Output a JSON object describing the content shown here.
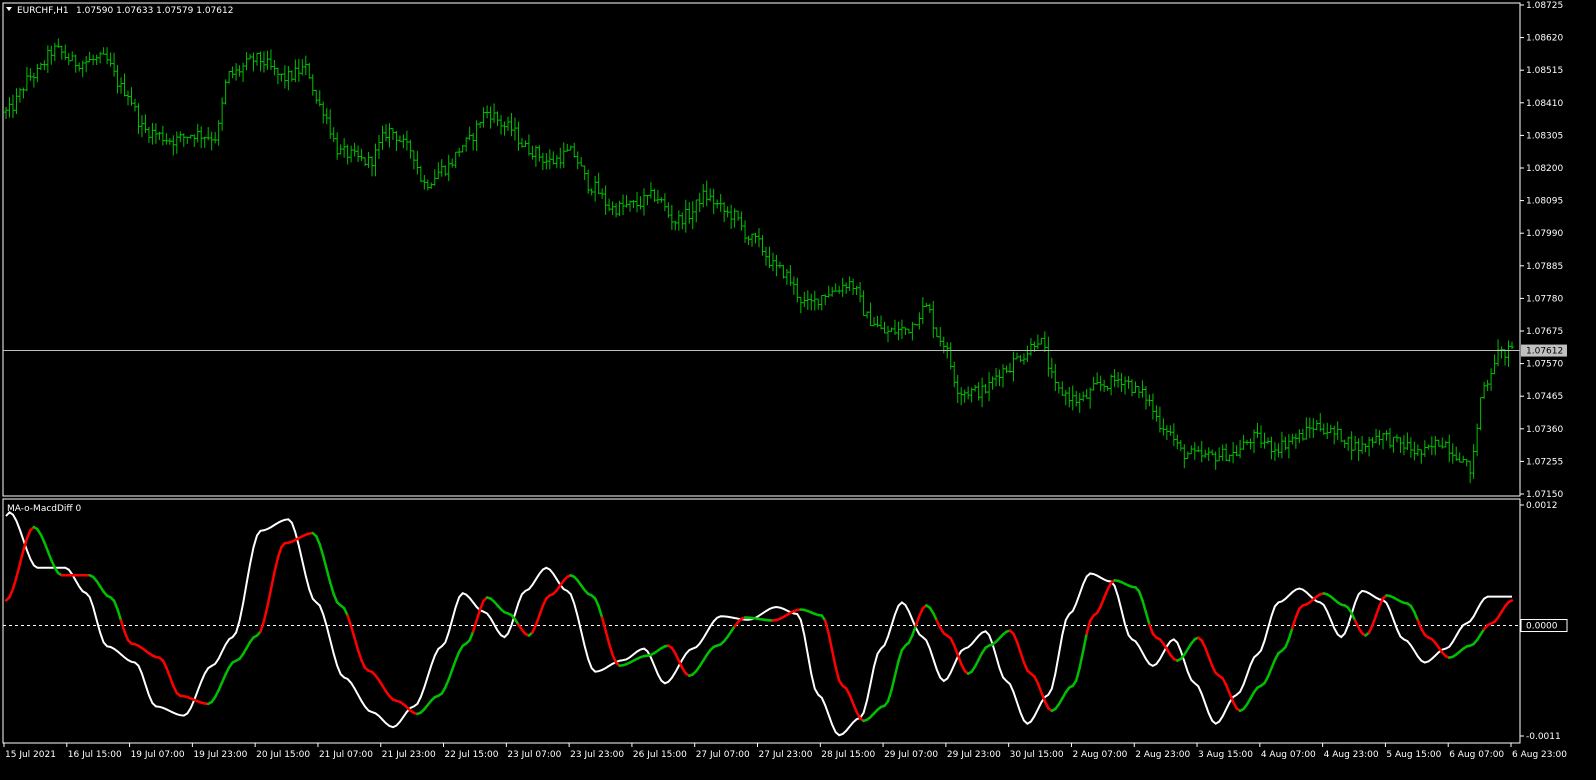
{
  "header": {
    "symbol_text": "EURCHF,H1",
    "ohlc_text": "1.07590 1.07633 1.07579 1.07612"
  },
  "indicator": {
    "name_text": "MA-o-MacdDiff 0",
    "zero_label": "0.0000"
  },
  "colors": {
    "background": "#000000",
    "frame": "#ffffff",
    "bars": "#00c000",
    "bid_line": "#c0c0c0",
    "signal_line": "#ffffff",
    "osc_up": "#00c000",
    "osc_down": "#ff0000",
    "zero_line": "#ffffff"
  },
  "chart_data": [
    {
      "type": "bar",
      "symbol": "EURCHF",
      "timeframe": "H1",
      "ylim": [
        1.0715,
        1.08725
      ],
      "yticks": [
        "1.08725",
        "1.08620",
        "1.08515",
        "1.08410",
        "1.08305",
        "1.08200",
        "1.08095",
        "1.07990",
        "1.07885",
        "1.07780",
        "1.07675",
        "1.07570",
        "1.07465",
        "1.07360",
        "1.07255",
        "1.07150"
      ],
      "current_price_label": "1.07612",
      "current_price": 1.07612,
      "xticks": [
        "15 Jul 2021",
        "16 Jul 15:00",
        "19 Jul 07:00",
        "19 Jul 23:00",
        "20 Jul 15:00",
        "21 Jul 07:00",
        "21 Jul 23:00",
        "22 Jul 15:00",
        "23 Jul 07:00",
        "23 Jul 23:00",
        "26 Jul 15:00",
        "27 Jul 07:00",
        "27 Jul 23:00",
        "28 Jul 15:00",
        "29 Jul 07:00",
        "29 Jul 23:00",
        "30 Jul 15:00",
        "2 Aug 07:00",
        "2 Aug 23:00",
        "3 Aug 15:00",
        "4 Aug 07:00",
        "4 Aug 23:00",
        "5 Aug 15:00",
        "6 Aug 07:00",
        "6 Aug 23:00"
      ],
      "close_anchors": [
        [
          0,
          1.0838
        ],
        [
          8,
          1.085
        ],
        [
          14,
          1.0858
        ],
        [
          20,
          1.0854
        ],
        [
          28,
          1.0855
        ],
        [
          34,
          1.0845
        ],
        [
          40,
          1.0832
        ],
        [
          48,
          1.0829
        ],
        [
          54,
          1.0831
        ],
        [
          60,
          1.083
        ],
        [
          64,
          1.085
        ],
        [
          72,
          1.0855
        ],
        [
          80,
          1.0849
        ],
        [
          86,
          1.0852
        ],
        [
          90,
          1.084
        ],
        [
          96,
          1.0825
        ],
        [
          104,
          1.0822
        ],
        [
          110,
          1.0832
        ],
        [
          116,
          1.0826
        ],
        [
          120,
          1.0815
        ],
        [
          126,
          1.082
        ],
        [
          132,
          1.0828
        ],
        [
          138,
          1.0838
        ],
        [
          144,
          1.0833
        ],
        [
          150,
          1.0826
        ],
        [
          156,
          1.0822
        ],
        [
          162,
          1.0825
        ],
        [
          168,
          1.0814
        ],
        [
          174,
          1.0807
        ],
        [
          180,
          1.0808
        ],
        [
          186,
          1.0811
        ],
        [
          192,
          1.0803
        ],
        [
          196,
          1.0805
        ],
        [
          200,
          1.0811
        ],
        [
          208,
          1.0805
        ],
        [
          214,
          1.0797
        ],
        [
          222,
          1.0787
        ],
        [
          230,
          1.0776
        ],
        [
          236,
          1.078
        ],
        [
          242,
          1.0783
        ],
        [
          248,
          1.0771
        ],
        [
          252,
          1.0767
        ],
        [
          258,
          1.0768
        ],
        [
          264,
          1.0775
        ],
        [
          268,
          1.0765
        ],
        [
          274,
          1.0748
        ],
        [
          280,
          1.0748
        ],
        [
          286,
          1.0755
        ],
        [
          292,
          1.076
        ],
        [
          296,
          1.0765
        ],
        [
          302,
          1.0748
        ],
        [
          308,
          1.0745
        ],
        [
          314,
          1.075
        ],
        [
          320,
          1.0752
        ],
        [
          326,
          1.0747
        ],
        [
          332,
          1.0737
        ],
        [
          338,
          1.0728
        ],
        [
          344,
          1.0727
        ],
        [
          352,
          1.0728
        ],
        [
          358,
          1.0733
        ],
        [
          364,
          1.073
        ],
        [
          370,
          1.0733
        ],
        [
          376,
          1.0737
        ],
        [
          382,
          1.0734
        ],
        [
          388,
          1.073
        ],
        [
          394,
          1.0734
        ],
        [
          400,
          1.0731
        ],
        [
          406,
          1.0728
        ],
        [
          412,
          1.0732
        ],
        [
          416,
          1.0728
        ],
        [
          420,
          1.0723
        ],
        [
          424,
          1.075
        ],
        [
          428,
          1.076
        ],
        [
          432,
          1.0761
        ]
      ],
      "osc_ylim": [
        -0.0011,
        0.0012
      ],
      "osc_yticks": [
        "0.0012",
        "0.0000",
        "-0.0011"
      ],
      "osc_anchors": [
        [
          0,
          0.00025
        ],
        [
          8,
          0.00098
        ],
        [
          16,
          0.0005
        ],
        [
          24,
          0.0005
        ],
        [
          30,
          0.00028
        ],
        [
          36,
          -0.00018
        ],
        [
          44,
          -0.00032
        ],
        [
          50,
          -0.0007
        ],
        [
          58,
          -0.00078
        ],
        [
          66,
          -0.00035
        ],
        [
          72,
          -0.0001
        ],
        [
          80,
          0.00082
        ],
        [
          88,
          0.00092
        ],
        [
          96,
          0.0002
        ],
        [
          104,
          -0.00045
        ],
        [
          112,
          -0.00075
        ],
        [
          118,
          -0.00088
        ],
        [
          124,
          -0.0007
        ],
        [
          132,
          -0.00018
        ],
        [
          138,
          0.00028
        ],
        [
          144,
          0.00012
        ],
        [
          150,
          -0.0001
        ],
        [
          156,
          0.0003
        ],
        [
          162,
          0.0005
        ],
        [
          168,
          0.0003
        ],
        [
          176,
          -0.0004
        ],
        [
          184,
          -0.0003
        ],
        [
          190,
          -0.0002
        ],
        [
          196,
          -0.0005
        ],
        [
          204,
          -0.0002
        ],
        [
          212,
          8e-05
        ],
        [
          220,
          5e-05
        ],
        [
          228,
          0.00016
        ],
        [
          234,
          0.0001
        ],
        [
          240,
          -0.0006
        ],
        [
          246,
          -0.00095
        ],
        [
          252,
          -0.0008
        ],
        [
          258,
          -0.0002
        ],
        [
          264,
          0.0002
        ],
        [
          270,
          -0.0001
        ],
        [
          276,
          -0.00048
        ],
        [
          282,
          -0.0002
        ],
        [
          288,
          -5e-05
        ],
        [
          294,
          -0.00048
        ],
        [
          300,
          -0.00085
        ],
        [
          306,
          -0.0006
        ],
        [
          312,
          0.0001
        ],
        [
          318,
          0.00045
        ],
        [
          324,
          0.00038
        ],
        [
          330,
          -0.00012
        ],
        [
          336,
          -0.00035
        ],
        [
          342,
          -0.00012
        ],
        [
          348,
          -0.0005
        ],
        [
          354,
          -0.00085
        ],
        [
          360,
          -0.0006
        ],
        [
          366,
          -0.00025
        ],
        [
          372,
          0.0002
        ],
        [
          378,
          0.00032
        ],
        [
          384,
          0.0002
        ],
        [
          390,
          -0.0001
        ],
        [
          396,
          0.0003
        ],
        [
          402,
          0.00022
        ],
        [
          408,
          -0.00012
        ],
        [
          414,
          -0.00032
        ],
        [
          420,
          -0.0002
        ],
        [
          426,
          2e-05
        ],
        [
          432,
          0.00025
        ]
      ]
    }
  ]
}
